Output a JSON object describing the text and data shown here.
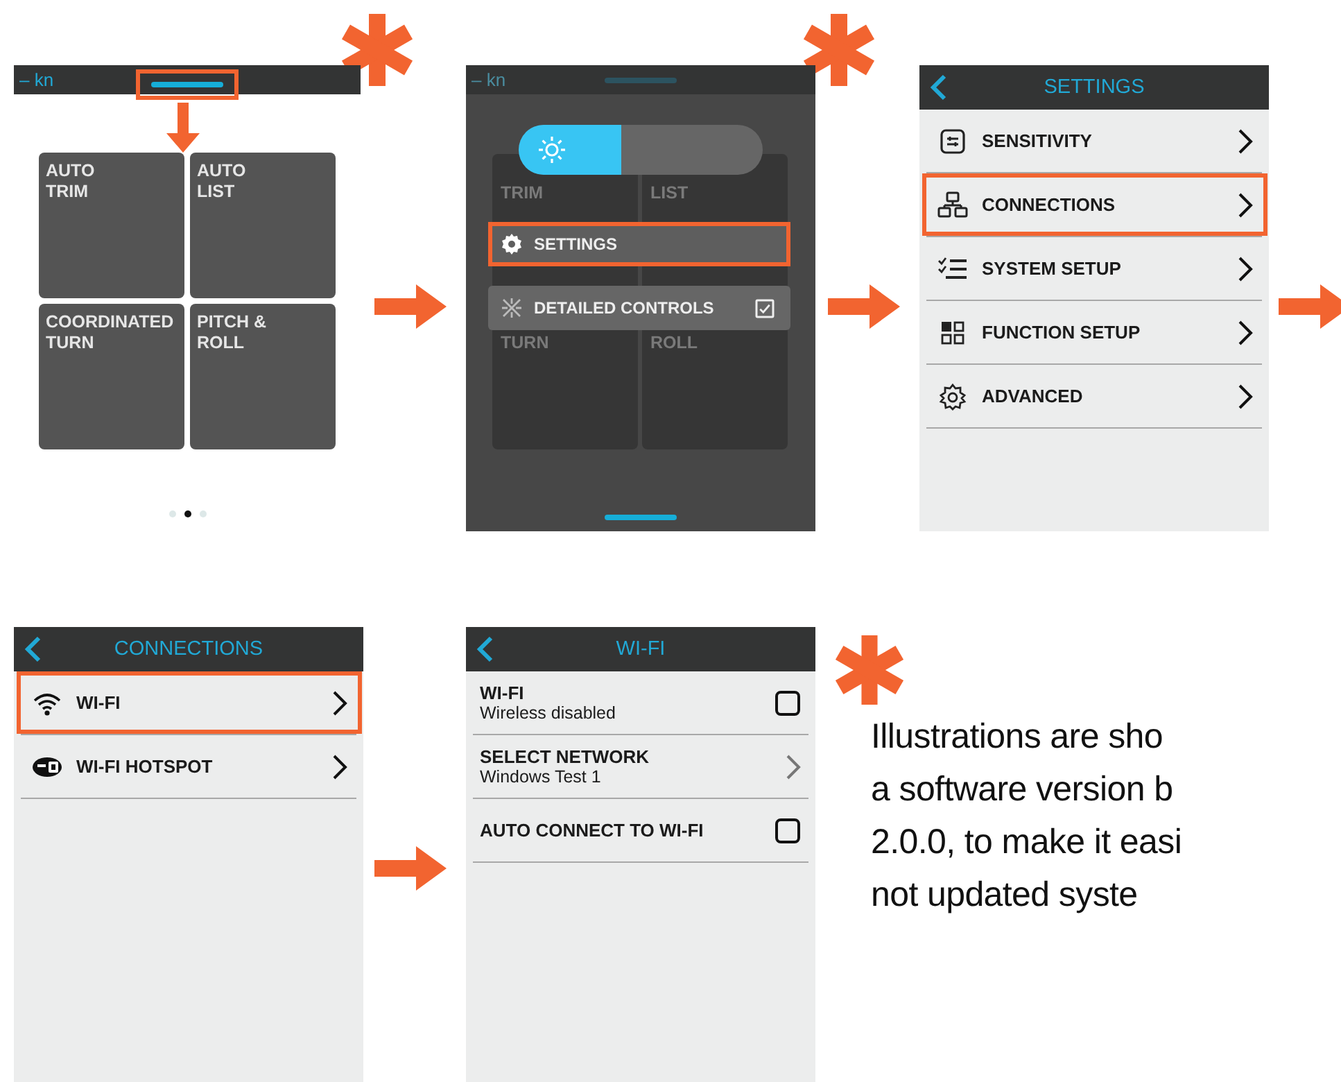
{
  "home_screen": {
    "speed": "– kn",
    "handle_highlighted": true,
    "tiles": [
      {
        "label": "AUTO\nTRIM"
      },
      {
        "label": "AUTO\nLIST"
      },
      {
        "label": "COORDINATED\nTURN"
      },
      {
        "label": "PITCH &\nROLL"
      }
    ],
    "page_dots": [
      {
        "selected": false
      },
      {
        "selected": true
      },
      {
        "selected": false
      }
    ]
  },
  "quick_menu": {
    "speed": "– kn",
    "brightness": {
      "level": 0.42
    },
    "background_tiles": [
      {
        "label": "TRIM"
      },
      {
        "label": "LIST"
      },
      {
        "label": "TURN"
      },
      {
        "label": "ROLL"
      }
    ],
    "items": [
      {
        "kind": "link",
        "label": "SETTINGS",
        "highlighted": true
      },
      {
        "kind": "checkbox",
        "label": "DETAILED CONTROLS",
        "checked": true,
        "highlighted": false
      }
    ]
  },
  "settings_screen": {
    "title": "SETTINGS",
    "items": [
      {
        "label": "SENSITIVITY",
        "highlighted": false
      },
      {
        "label": "CONNECTIONS",
        "highlighted": true
      },
      {
        "label": "SYSTEM SETUP",
        "highlighted": false
      },
      {
        "label": "FUNCTION SETUP",
        "highlighted": false
      },
      {
        "label": "ADVANCED",
        "highlighted": false
      }
    ]
  },
  "connections_screen": {
    "title": "CONNECTIONS",
    "items": [
      {
        "label": "WI-FI",
        "highlighted": true
      },
      {
        "label": "WI-FI HOTSPOT",
        "highlighted": false
      }
    ]
  },
  "wifi_screen": {
    "title": "WI-FI",
    "items": [
      {
        "kind": "checkbox",
        "title": "WI-FI",
        "subtitle": "Wireless disabled",
        "checked": false
      },
      {
        "kind": "link",
        "title": "SELECT NETWORK",
        "subtitle": "Windows Test 1"
      },
      {
        "kind": "checkbox",
        "title": "AUTO CONNECT TO WI-FI",
        "checked": false
      }
    ]
  },
  "note": {
    "lines": [
      "Illustrations are sho",
      "a software version b",
      "2.0.0, to make it easi",
      "not updated syste"
    ]
  }
}
